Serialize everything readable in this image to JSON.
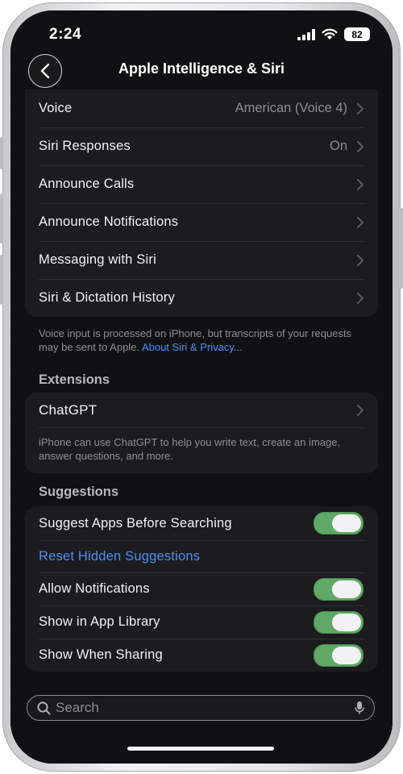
{
  "status_bar": {
    "time": "2:24",
    "battery": "82"
  },
  "nav": {
    "title": "Apple Intelligence & Siri"
  },
  "group1": {
    "rows": [
      {
        "label": "Voice",
        "value": "American (Voice 4)"
      },
      {
        "label": "Siri Responses",
        "value": "On"
      },
      {
        "label": "Announce Calls",
        "value": ""
      },
      {
        "label": "Announce Notifications",
        "value": ""
      },
      {
        "label": "Messaging with Siri",
        "value": ""
      },
      {
        "label": "Siri & Dictation History",
        "value": ""
      }
    ],
    "footer": "Voice input is processed on iPhone, but transcripts of your requests may be sent to Apple.",
    "footer_link": "About Siri & Privacy..."
  },
  "extensions": {
    "header": "Extensions",
    "chatgpt_label": "ChatGPT",
    "chatgpt_footer": "iPhone can use ChatGPT to help you write text, create an image, answer questions, and more."
  },
  "suggestions": {
    "header": "Suggestions",
    "suggest_apps": {
      "label": "Suggest Apps Before Searching",
      "on": true
    },
    "reset_label": "Reset Hidden Suggestions",
    "allow_notifications": {
      "label": "Allow Notifications",
      "on": true
    },
    "show_in_library": {
      "label": "Show in App Library",
      "on": true
    },
    "show_when_sharing": {
      "label": "Show When Sharing",
      "on": true
    }
  },
  "search": {
    "placeholder": "Search"
  },
  "colors": {
    "toggle_on": "#5fa865",
    "link": "#4c8ff5",
    "background": "#111113",
    "group": "#1c1c1e"
  },
  "icons": {
    "back": "chevron-left-icon",
    "search": "magnifier-icon",
    "mic": "microphone-icon"
  }
}
